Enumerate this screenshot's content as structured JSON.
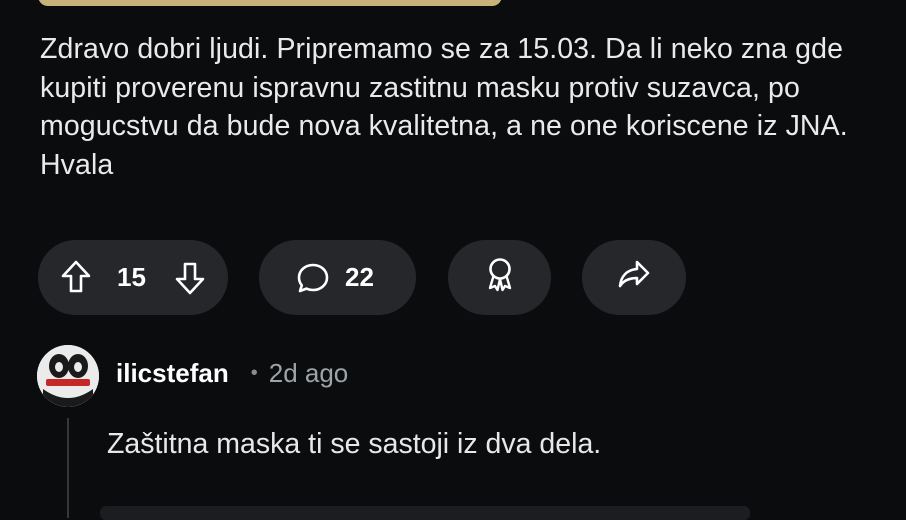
{
  "post": {
    "body": "Zdravo dobri ljudi. Pripremamo se za 15.03. Da li neko zna gde kupiti proverenu ispravnu zastitnu masku protiv suzavca, po mogucstvu da bude nova kvalitetna, a ne one koriscene iz JNA. Hvala"
  },
  "actions": {
    "vote_count": "15",
    "comment_count": "22"
  },
  "icons": {
    "upvote": "arrow-up-icon",
    "downvote": "arrow-down-icon",
    "comments": "speech-bubble-icon",
    "award": "award-ribbon-icon",
    "share": "share-arrow-icon"
  },
  "comment": {
    "username": "ilicstefan",
    "separator": "•",
    "age": "2d ago",
    "body": "Zaštitna maska ti se sastoji iz dva dela."
  },
  "colors": {
    "background": "#0b0c0e",
    "pill": "#25272b",
    "flair": "#c7b27a",
    "text": "#e8eaec",
    "muted": "#9ea3a8"
  }
}
